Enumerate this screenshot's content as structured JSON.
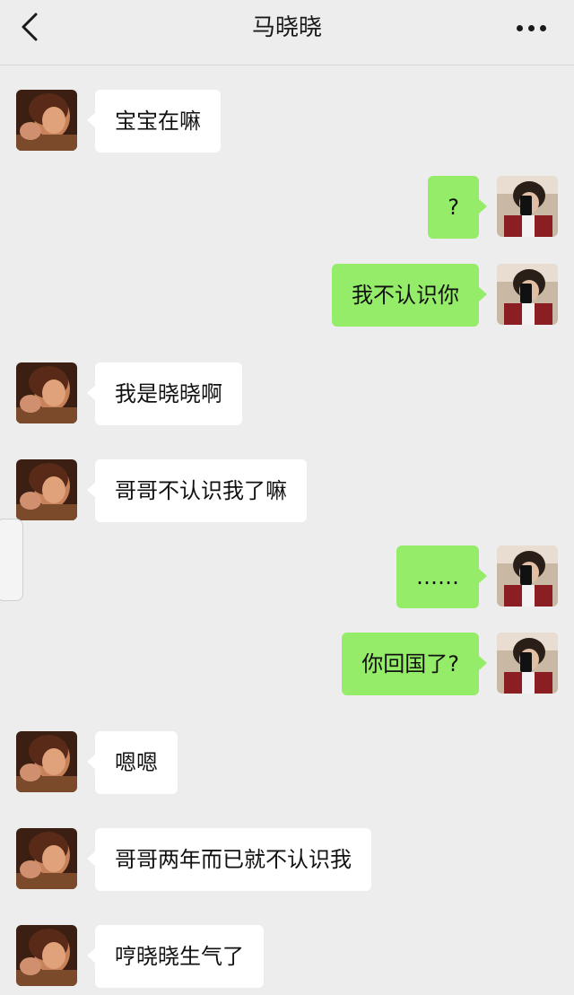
{
  "header": {
    "title": "马晓晓",
    "back_icon": "chevron-left-icon",
    "more_icon": "more-dots-icon"
  },
  "messages": [
    {
      "sender": "contact",
      "text": "宝宝在嘛"
    },
    {
      "sender": "me",
      "text": "?"
    },
    {
      "sender": "me",
      "text": "我不认识你"
    },
    {
      "sender": "contact",
      "text": "我是晓晓啊"
    },
    {
      "sender": "contact",
      "text": "哥哥不认识我了嘛"
    },
    {
      "sender": "me",
      "text": "……"
    },
    {
      "sender": "me",
      "text": "你回国了?"
    },
    {
      "sender": "contact",
      "text": "嗯嗯"
    },
    {
      "sender": "contact",
      "text": "哥哥两年而已就不认识我"
    },
    {
      "sender": "contact",
      "text": "哼晓晓生气了"
    }
  ],
  "colors": {
    "background": "#ededed",
    "incoming_bubble": "#ffffff",
    "outgoing_bubble": "#95ec69"
  }
}
